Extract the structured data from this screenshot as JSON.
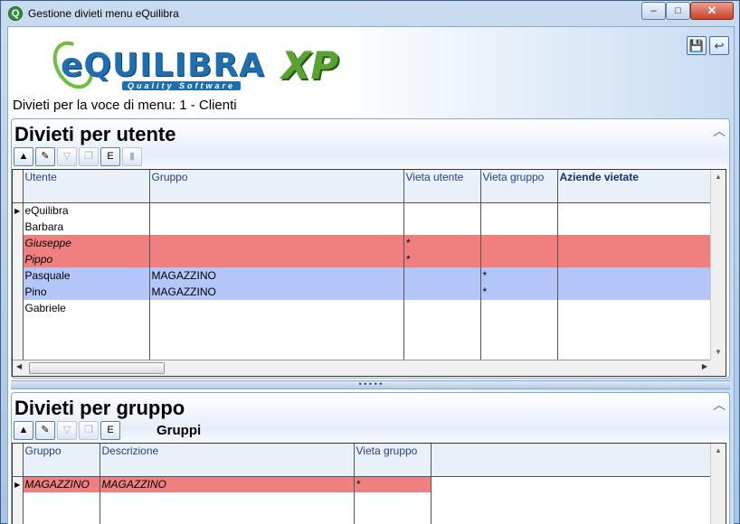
{
  "window": {
    "title": "Gestione divieti menu eQuilibra",
    "app_icon": "Q",
    "min_label": "–",
    "max_label": "□",
    "close_label": "✕"
  },
  "logo": {
    "main": "eQUILIBRA",
    "sub": "Quality Software",
    "suffix": "XP"
  },
  "toolbar": {
    "save_icon": "💾",
    "exit_icon": "↩"
  },
  "subtitle": "Divieti per la voce di menu: 1 - Clienti",
  "panel_users": {
    "title": "Divieti per utente",
    "columns": [
      "Utente",
      "Gruppo",
      "Vieta utente",
      "Vieta gruppo",
      "Aziende vietate"
    ],
    "rows": [
      {
        "utente": "eQuilibra",
        "gruppo": "",
        "vieta_utente": "",
        "vieta_gruppo": "",
        "aziende": "",
        "style": "normal"
      },
      {
        "utente": "Barbara",
        "gruppo": "",
        "vieta_utente": "",
        "vieta_gruppo": "",
        "aziende": "",
        "style": "normal"
      },
      {
        "utente": "Giuseppe",
        "gruppo": "",
        "vieta_utente": "*",
        "vieta_gruppo": "",
        "aziende": "",
        "style": "red"
      },
      {
        "utente": "Pippo",
        "gruppo": "",
        "vieta_utente": "*",
        "vieta_gruppo": "",
        "aziende": "",
        "style": "red"
      },
      {
        "utente": "Pasquale",
        "gruppo": "MAGAZZINO",
        "vieta_utente": "",
        "vieta_gruppo": "*",
        "aziende": "",
        "style": "blue"
      },
      {
        "utente": "Pino",
        "gruppo": "MAGAZZINO",
        "vieta_utente": "",
        "vieta_gruppo": "*",
        "aziende": "",
        "style": "blue"
      },
      {
        "utente": "Gabriele",
        "gruppo": "",
        "vieta_utente": "",
        "vieta_gruppo": "",
        "aziende": "",
        "style": "normal"
      }
    ]
  },
  "panel_groups": {
    "title": "Divieti per gruppo",
    "toolbar_label": "Gruppi",
    "columns": [
      "Gruppo",
      "Descrizione",
      "Vieta gruppo"
    ],
    "rows": [
      {
        "gruppo": "MAGAZZINO",
        "descrizione": "MAGAZZINO",
        "vieta_gruppo": "*",
        "style": "red"
      }
    ]
  },
  "colors": {
    "denied_row": "#f08080",
    "group_denied_row": "#b4c6f7"
  }
}
